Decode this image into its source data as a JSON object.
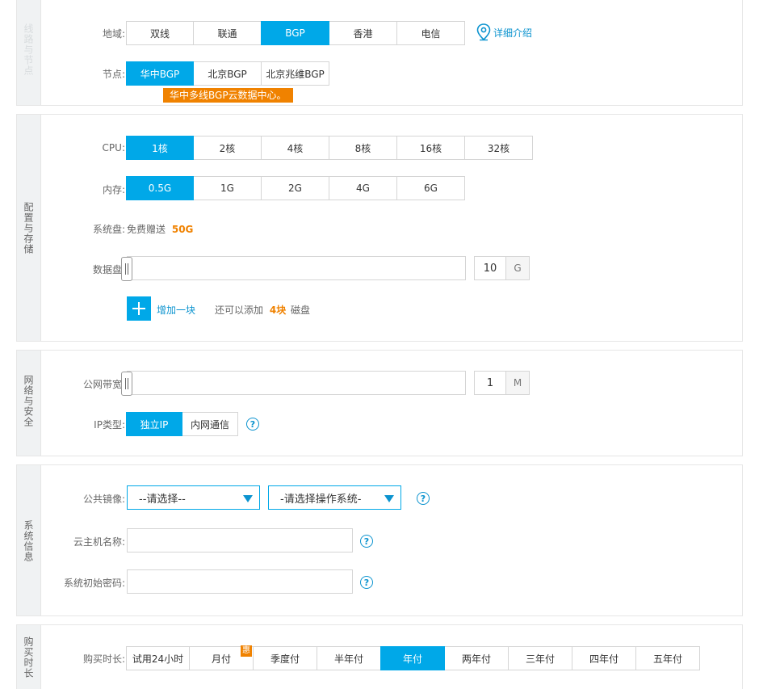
{
  "sections": {
    "region": "线路与节点",
    "config": "配置与存储",
    "network": "网络与安全",
    "system": "系统信息",
    "duration": "购买时长"
  },
  "region": {
    "label": "地域:",
    "options": [
      "双线",
      "联通",
      "BGP",
      "香港",
      "电信"
    ],
    "active": "BGP",
    "detail_link": "详细介绍"
  },
  "node": {
    "label": "节点:",
    "options": [
      "华中BGP",
      "北京BGP",
      "北京兆维BGP"
    ],
    "active": "华中BGP",
    "tooltip": "华中多线BGP云数据中心。"
  },
  "cpu": {
    "label": "CPU:",
    "options": [
      "1核",
      "2核",
      "4核",
      "8核",
      "16核",
      "32核"
    ],
    "active": "1核"
  },
  "memory": {
    "label": "内存:",
    "options": [
      "0.5G",
      "1G",
      "2G",
      "4G",
      "6G"
    ],
    "active": "0.5G"
  },
  "system_disk": {
    "label": "系统盘:",
    "text": "免费赠送",
    "size": "50G"
  },
  "data_disk": {
    "label": "数据盘:",
    "value": "10",
    "unit": "G",
    "add_label": "增加一块",
    "remaining_prefix": "还可以添加",
    "remaining_count": "4块",
    "remaining_suffix": "磁盘"
  },
  "bandwidth": {
    "label": "公网带宽:",
    "value": "1",
    "unit": "M"
  },
  "ip_type": {
    "label": "IP类型:",
    "options": [
      "独立IP",
      "内网通信"
    ],
    "active": "独立IP"
  },
  "image": {
    "label": "公共镜像:",
    "select1": "--请选择--",
    "select2": "-请选择操作系统-"
  },
  "hostname": {
    "label": "云主机名称:",
    "value": ""
  },
  "password": {
    "label": "系统初始密码:",
    "value": ""
  },
  "purchase": {
    "label": "购买时长:",
    "options": [
      "试用24小时",
      "月付",
      "季度付",
      "半年付",
      "年付",
      "两年付",
      "三年付",
      "四年付",
      "五年付"
    ],
    "active": "年付",
    "discount_badge": "惠"
  },
  "icons": {
    "location": "location-pin-icon",
    "help": "question-circle-icon",
    "add": "plus-icon",
    "caret": "caret-down-icon"
  },
  "colors": {
    "accent": "#00a8e8",
    "link": "#0b93cf",
    "highlight": "#f08200"
  }
}
